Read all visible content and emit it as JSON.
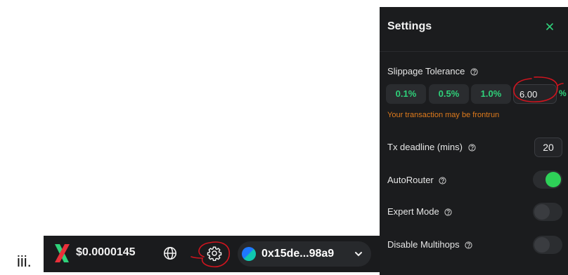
{
  "caption": "iii.",
  "toolbar": {
    "price": "$0.0000145",
    "wallet_address": "0x15de...98a9"
  },
  "settings": {
    "title": "Settings",
    "slippage_label": "Slippage Tolerance",
    "slippage_options": [
      "0.1%",
      "0.5%",
      "1.0%"
    ],
    "slippage_value": "6.00",
    "slippage_unit": "%",
    "warning": "Your transaction may be frontrun",
    "deadline_label": "Tx deadline (mins)",
    "deadline_value": "20",
    "autorouter_label": "AutoRouter",
    "autorouter_on": true,
    "expert_label": "Expert Mode",
    "expert_on": false,
    "multihops_label": "Disable Multihops",
    "multihops_on": false
  },
  "colors": {
    "accent_green": "#2fd17a",
    "toggle_on": "#2ed158",
    "warning_orange": "#e07b1c",
    "annotation_red": "#d0141e",
    "panel_bg": "#1b1c1e"
  },
  "icons": [
    "x-logo-icon",
    "globe-icon",
    "gear-icon",
    "wallet-avatar-icon",
    "chevron-down-icon",
    "close-icon",
    "help-circle-icon"
  ]
}
